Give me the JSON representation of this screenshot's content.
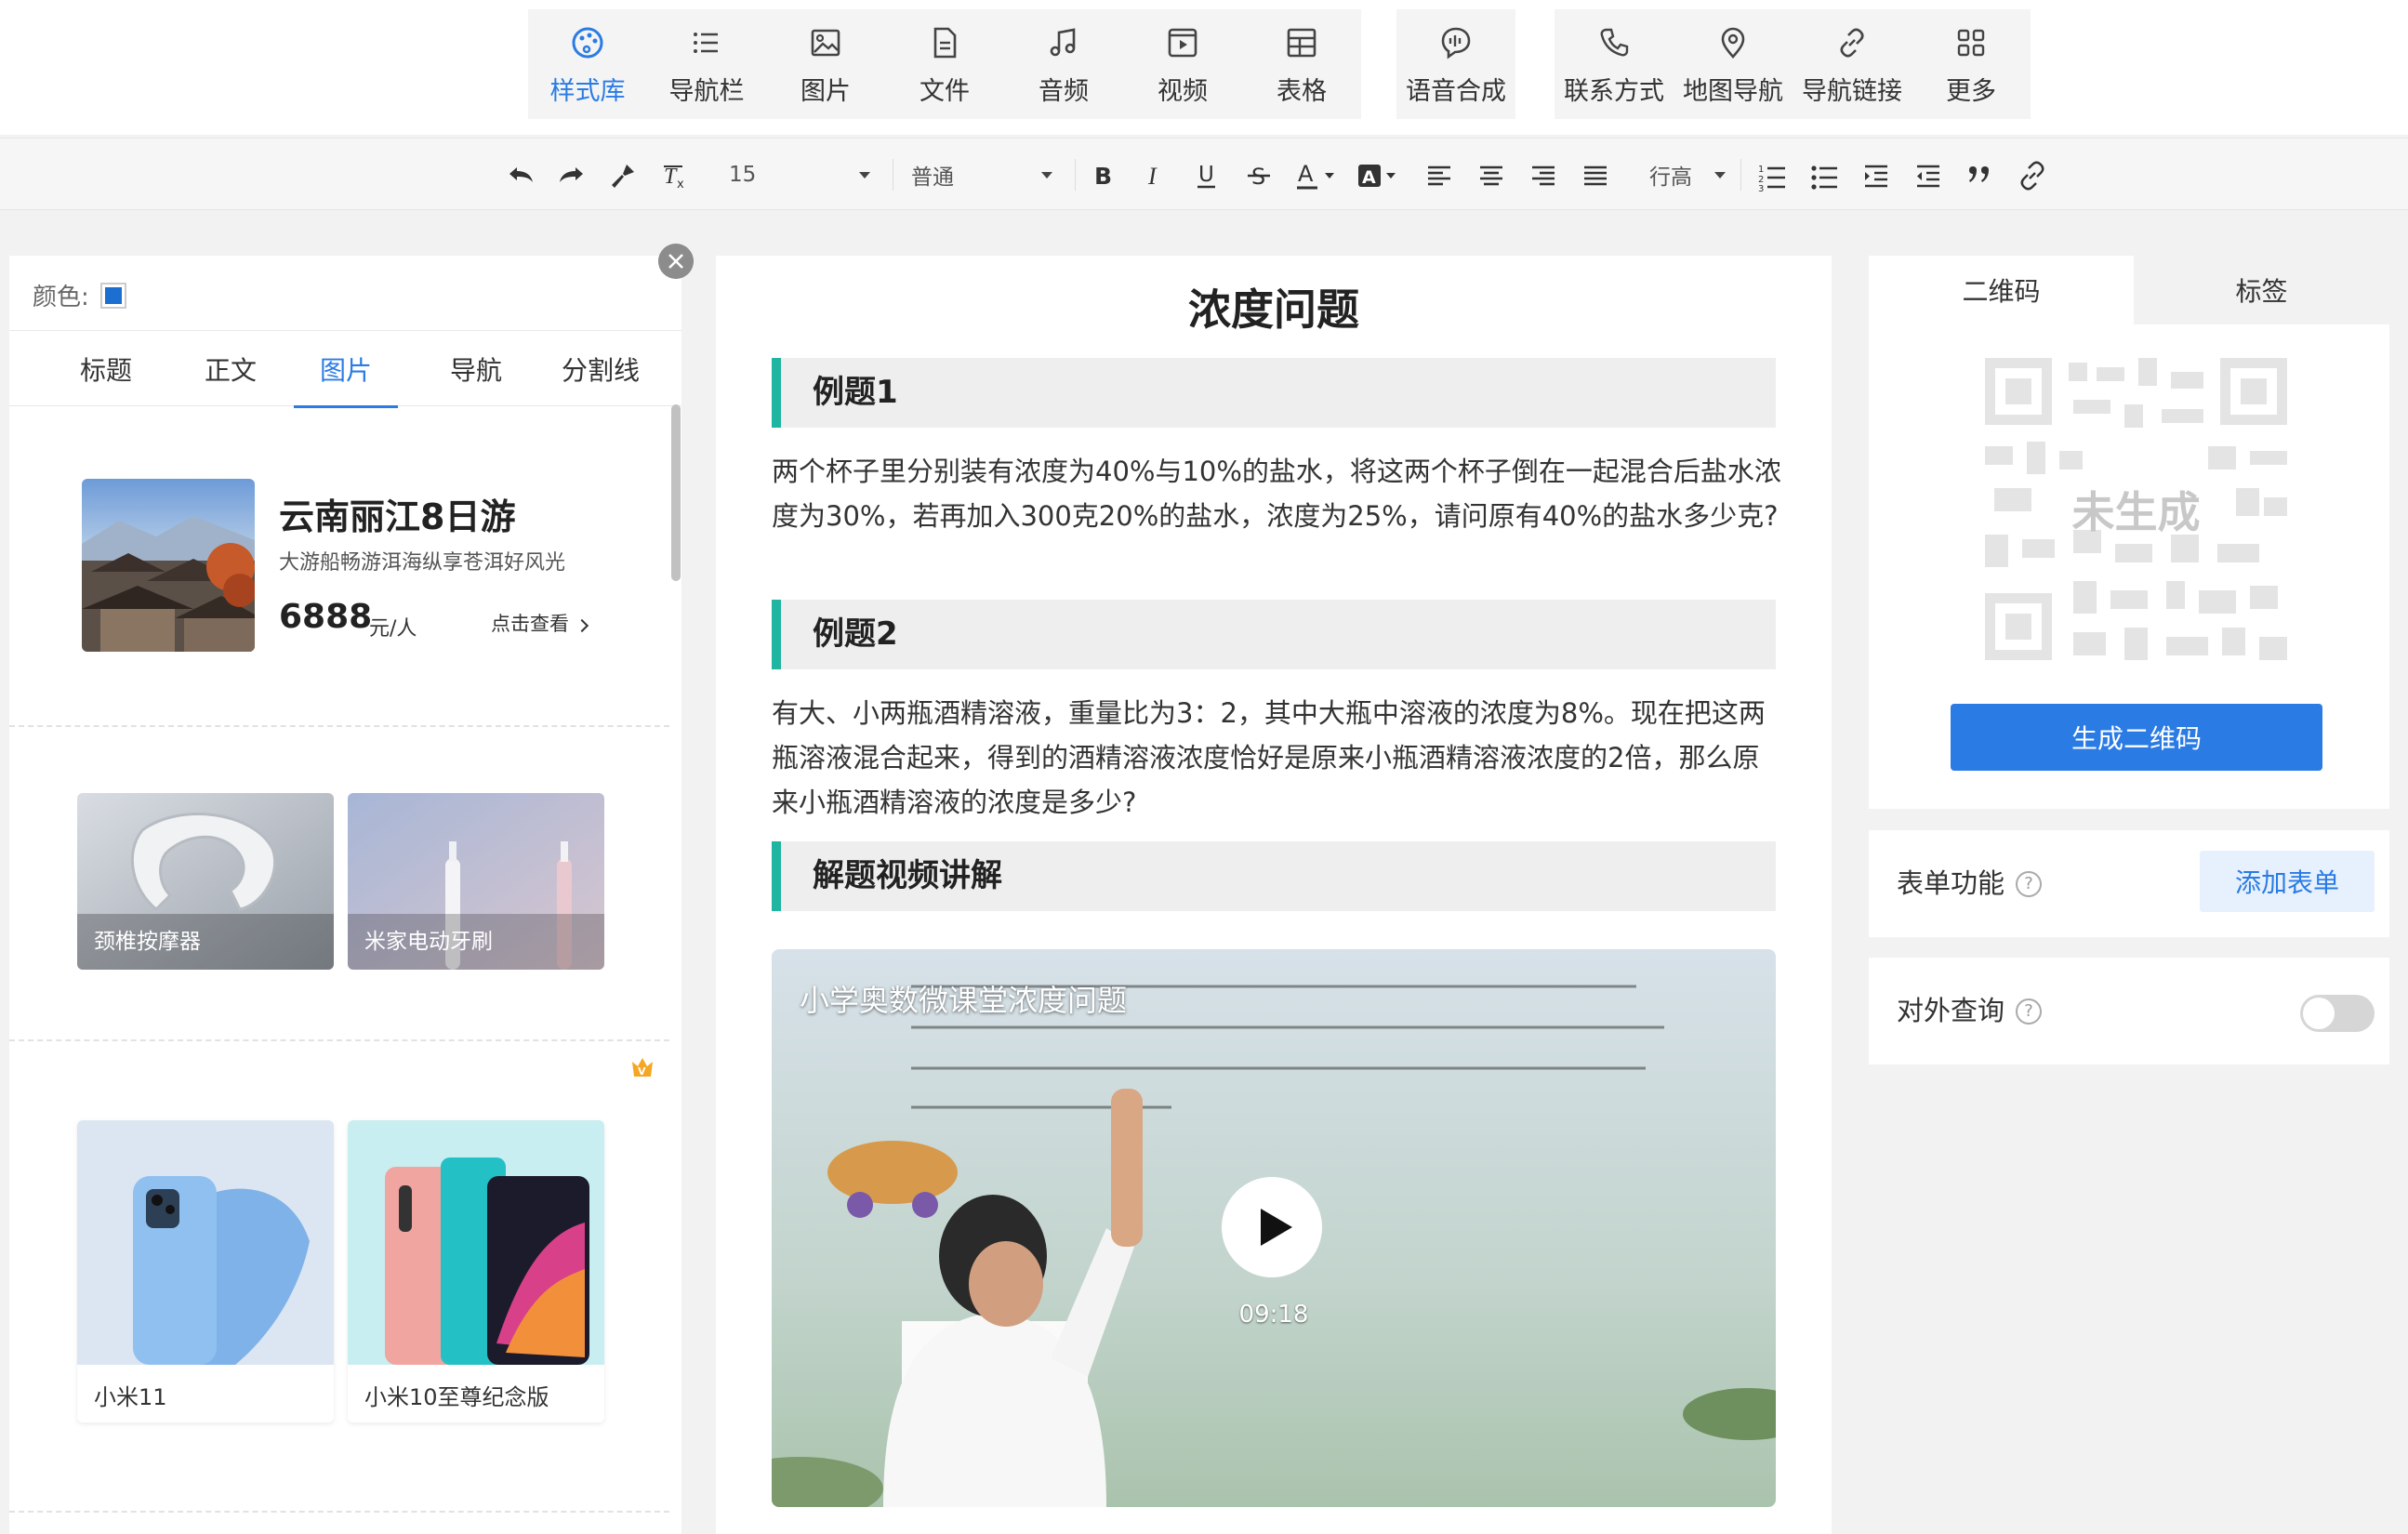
{
  "insert_toolbar": {
    "items": [
      {
        "label": "样式库",
        "icon": "palette-icon",
        "active": true
      },
      {
        "label": "导航栏",
        "icon": "list-icon"
      },
      {
        "label": "图片",
        "icon": "image-icon"
      },
      {
        "label": "文件",
        "icon": "file-icon"
      },
      {
        "label": "音频",
        "icon": "music-icon"
      },
      {
        "label": "视频",
        "icon": "video-icon"
      },
      {
        "label": "表格",
        "icon": "table-icon"
      },
      {
        "label": "语音合成",
        "icon": "voice-icon"
      },
      {
        "label": "联系方式",
        "icon": "phone-icon"
      },
      {
        "label": "地图导航",
        "icon": "map-pin-icon"
      },
      {
        "label": "导航链接",
        "icon": "link-icon"
      },
      {
        "label": "更多",
        "icon": "grid-more-icon"
      }
    ]
  },
  "format_toolbar": {
    "font_size": "15",
    "paragraph_style": "普通",
    "line_height_label": "行高"
  },
  "left_panel": {
    "color_label": "颜色:",
    "color_value": "#1c6fd1",
    "tabs": [
      "标题",
      "正文",
      "图片",
      "导航",
      "分割线"
    ],
    "active_tab": "图片",
    "travel_card": {
      "title": "云南丽江8日游",
      "subtitle": "大游船畅游洱海纵享苍洱好风光",
      "price": "6888",
      "unit": "元/人",
      "link": "点击查看"
    },
    "tiles": [
      "颈椎按摩器",
      "米家电动牙刷"
    ],
    "products": [
      "小米11",
      "小米10至尊纪念版"
    ]
  },
  "editor": {
    "title": "浓度问题",
    "sections": [
      "例题1",
      "例题2",
      "解题视频讲解"
    ],
    "para1": "两个杯子里分别装有浓度为40%与10%的盐水，将这两个杯子倒在一起混合后盐水浓度为30%，若再加入300克20%的盐水，浓度为25%，请问原有40%的盐水多少克?",
    "para2": "有大、小两瓶酒精溶液，重量比为3：2，其中大瓶中溶液的浓度为8%。现在把这两瓶溶液混合起来，得到的酒精溶液浓度恰好是原来小瓶酒精溶液浓度的2倍，那么原来小瓶酒精溶液的浓度是多少?",
    "video": {
      "title": "小学奥数微课堂浓度问题",
      "duration": "09:18"
    }
  },
  "right_panel": {
    "tabs": [
      "二维码",
      "标签"
    ],
    "active_tab": "二维码",
    "qr_status": "未生成",
    "generate_button": "生成二维码",
    "form_label": "表单功能",
    "add_form_button": "添加表单",
    "query_label": "对外查询",
    "query_enabled": false,
    "help_mark": "?"
  }
}
